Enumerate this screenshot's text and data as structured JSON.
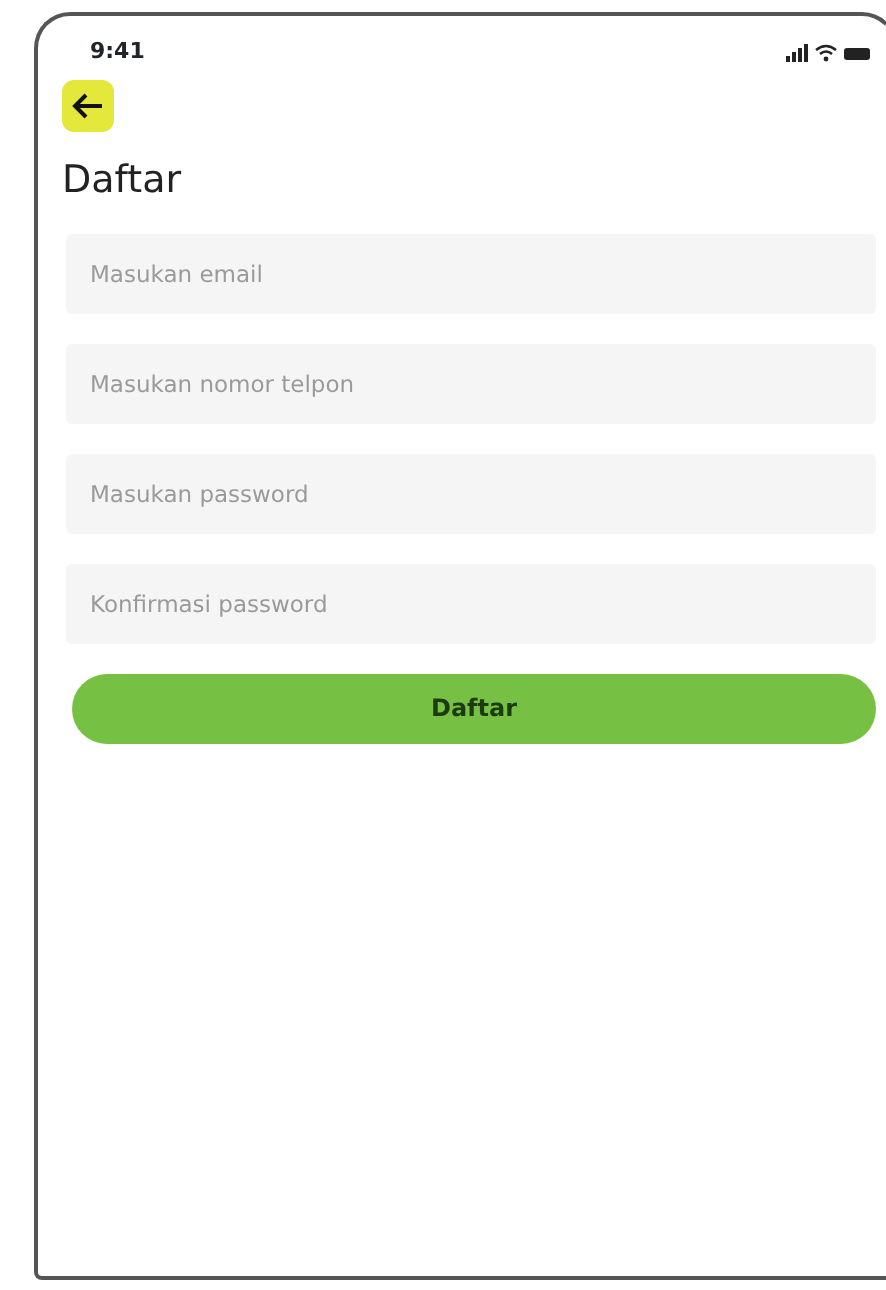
{
  "status_bar": {
    "time": "9:41"
  },
  "title": "Daftar",
  "fields": [
    {
      "placeholder": "Masukan email"
    },
    {
      "placeholder": "Masukan nomor telpon"
    },
    {
      "placeholder": "Masukan password"
    },
    {
      "placeholder": "Konfirmasi password"
    }
  ],
  "submit_button": {
    "label": "Daftar"
  }
}
